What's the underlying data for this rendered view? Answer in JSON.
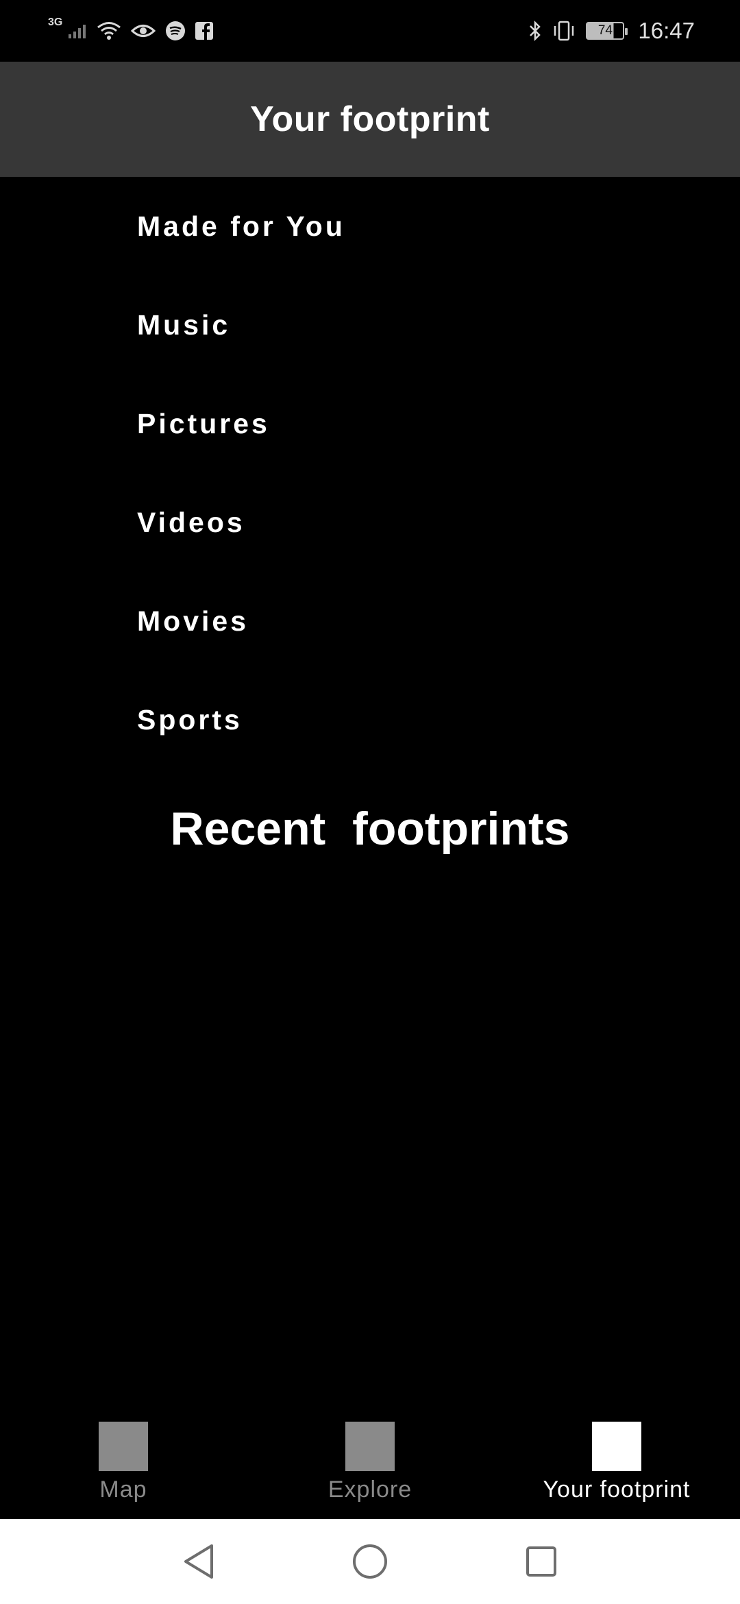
{
  "status_bar": {
    "network_label": "3G",
    "battery_level": "74",
    "time": "16:47",
    "icons_left": [
      "signal-icon",
      "wifi-icon",
      "eye-icon",
      "spotify-icon",
      "facebook-icon"
    ],
    "icons_right": [
      "bluetooth-icon",
      "vibrate-icon",
      "battery-icon"
    ]
  },
  "header": {
    "title": "Your footprint"
  },
  "categories": [
    {
      "label": "Made for You"
    },
    {
      "label": "Music"
    },
    {
      "label": "Pictures"
    },
    {
      "label": "Videos"
    },
    {
      "label": "Movies"
    },
    {
      "label": "Sports"
    }
  ],
  "section": {
    "title": "Recent  footprints"
  },
  "bottom_nav": {
    "tabs": [
      {
        "label": "Map",
        "active": false
      },
      {
        "label": "Explore",
        "active": false
      },
      {
        "label": "Your footprint",
        "active": true
      }
    ]
  },
  "colors": {
    "background": "#000000",
    "app_bar": "#373737",
    "inactive": "#8a8a8a",
    "active": "#ffffff"
  }
}
